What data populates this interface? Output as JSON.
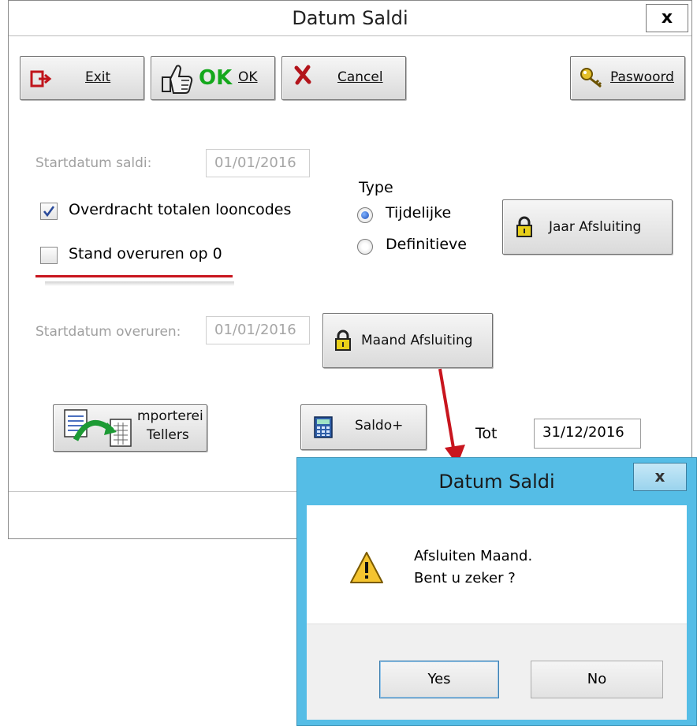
{
  "main_window": {
    "title": "Datum Saldi",
    "close_glyph": "x",
    "toolbar": {
      "exit_label": "Exit",
      "ok_icon_text": "OK",
      "ok_label": "OK",
      "cancel_label": "Cancel",
      "password_label": "Paswoord"
    },
    "startdatum_saldi": {
      "label": "Startdatum saldi:",
      "value": "01/01/2016"
    },
    "overdracht": {
      "label": "Overdracht totalen looncodes",
      "checked": true
    },
    "stand_overuren": {
      "label": "Stand overuren op 0",
      "checked": false
    },
    "type_group": {
      "label": "Type",
      "options": [
        {
          "label": "Tijdelijke",
          "selected": true
        },
        {
          "label": "Definitieve",
          "selected": false
        }
      ]
    },
    "jaar_afsluiting_label": "Jaar Afsluiting",
    "startdatum_overuren": {
      "label": "Startdatum overuren:",
      "value": "01/01/2016"
    },
    "maand_afsluiting_label": "Maand Afsluiting",
    "importeren": {
      "line1": "mporterei",
      "line2": "Tellers"
    },
    "saldo_label": "Saldo+",
    "tot": {
      "label": "Tot",
      "value": "31/12/2016"
    }
  },
  "dialog": {
    "title": "Datum Saldi",
    "close_glyph": "x",
    "message_line1": "Afsluiten Maand.",
    "message_line2": "Bent u zeker ?",
    "yes_label": "Yes",
    "no_label": "No"
  },
  "icons": {
    "exit": "exit-arrow-icon",
    "ok": "thumbs-up-icon",
    "cancel": "red-x-icon",
    "password": "key-icon",
    "lock": "padlock-icon",
    "import": "import-document-icon",
    "calculator": "calculator-icon",
    "warning": "warning-triangle-icon"
  },
  "colors": {
    "dialog_frame": "#55bde6",
    "annotation": "#c8151e",
    "ok_green": "#14a81c"
  }
}
